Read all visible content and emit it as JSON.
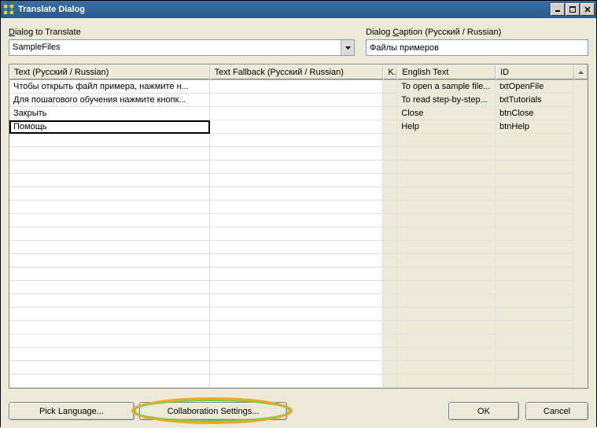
{
  "window": {
    "title": "Translate Dialog"
  },
  "labels": {
    "dialog_to_translate": "Dialog to Translate",
    "dialog_to_translate_ul": "D",
    "dialog_caption": "Dialog Caption (Русский / Russian)",
    "dialog_caption_ul": "C"
  },
  "dropdown": {
    "selected": "SampleFiles"
  },
  "caption_value": "Файлы примеров",
  "columns": {
    "text": "Text (Русский / Russian)",
    "fallback": "Text Fallback (Русский / Russian)",
    "k": "K..",
    "english": "English Text",
    "id": "ID"
  },
  "col_widths": {
    "text": 255,
    "fallback": 221,
    "k": 18,
    "english": 125,
    "id": 100
  },
  "rows": [
    {
      "text": "Чтобы открыть файл примера, нажмите н...",
      "fallback": "",
      "k": "",
      "english": "To open a sample file...",
      "id": "txtOpenFile"
    },
    {
      "text": "Для пошагового обучения нажмите кнопк...",
      "fallback": "",
      "k": "",
      "english": "To read step-by-step...",
      "id": "txtTutorials"
    },
    {
      "text": "Закрыть",
      "fallback": "",
      "k": "",
      "english": "Close",
      "id": "btnClose"
    },
    {
      "text": "Помощь",
      "fallback": "",
      "k": "",
      "english": "Help",
      "id": "btnHelp",
      "editing": true
    }
  ],
  "empty_row_count": 20,
  "buttons": {
    "pick_language": "Pick Language...",
    "collab": "Collaboration Settings...",
    "ok": "OK",
    "cancel": "Cancel"
  },
  "highlight": {
    "color_outer": "#f5a623",
    "color_inner": "#7ac943"
  }
}
